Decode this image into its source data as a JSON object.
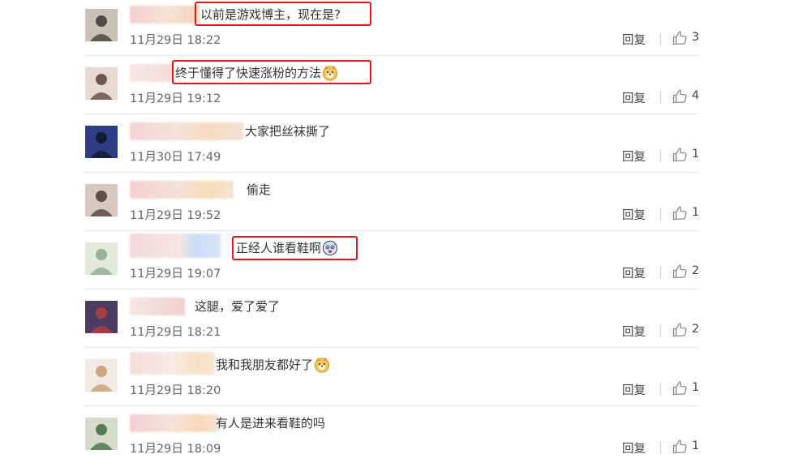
{
  "comments": [
    {
      "text": "以前是游戏博主，现在是?",
      "time": "11月29日  18:22",
      "reply_label": "回复",
      "likes": "3",
      "highlighted": true,
      "emoji": "",
      "avatar_colors": [
        "#c9c1b7",
        "#3b3533"
      ]
    },
    {
      "text": "终于懂得了快速涨粉的方法",
      "time": "11月29日  19:12",
      "reply_label": "回复",
      "likes": "4",
      "highlighted": true,
      "emoji": "doge-emoji",
      "avatar_colors": [
        "#e9d9d3",
        "#5a4038"
      ]
    },
    {
      "text": "大家把丝袜撕了",
      "time": "11月30日  17:49",
      "reply_label": "回复",
      "likes": "1",
      "highlighted": false,
      "emoji": "",
      "avatar_colors": [
        "#2f3c86",
        "#121526"
      ]
    },
    {
      "text": "偷走",
      "time": "11月29日  19:52",
      "reply_label": "回复",
      "likes": "1",
      "highlighted": false,
      "emoji": "",
      "avatar_colors": [
        "#d8c8c0",
        "#4a3a36"
      ]
    },
    {
      "text": "正经人谁看鞋啊",
      "time": "11月29日  19:07",
      "reply_label": "回复",
      "likes": "2",
      "highlighted": true,
      "emoji": "sweat-emoji",
      "avatar_colors": [
        "#e3eadc",
        "#8ba987"
      ]
    },
    {
      "text": "这腿，爱了爱了",
      "time": "11月29日  18:21",
      "reply_label": "回复",
      "likes": "2",
      "highlighted": false,
      "emoji": "",
      "avatar_colors": [
        "#4b3d5f",
        "#b5403b"
      ]
    },
    {
      "text": "我和我朋友都好了",
      "time": "11月29日  18:20",
      "reply_label": "回复",
      "likes": "1",
      "highlighted": false,
      "emoji": "doge-emoji",
      "avatar_colors": [
        "#f1ebe3",
        "#c69a6e"
      ]
    },
    {
      "text": "有人是进来看鞋的吗",
      "time": "11月29日  18:09",
      "reply_label": "回复",
      "likes": "1",
      "highlighted": false,
      "emoji": "",
      "avatar_colors": [
        "#d5dccb",
        "#3d6b3b"
      ]
    }
  ],
  "colors": {
    "highlight_border": "#e4141b",
    "text": "#333333",
    "meta": "#666666"
  }
}
